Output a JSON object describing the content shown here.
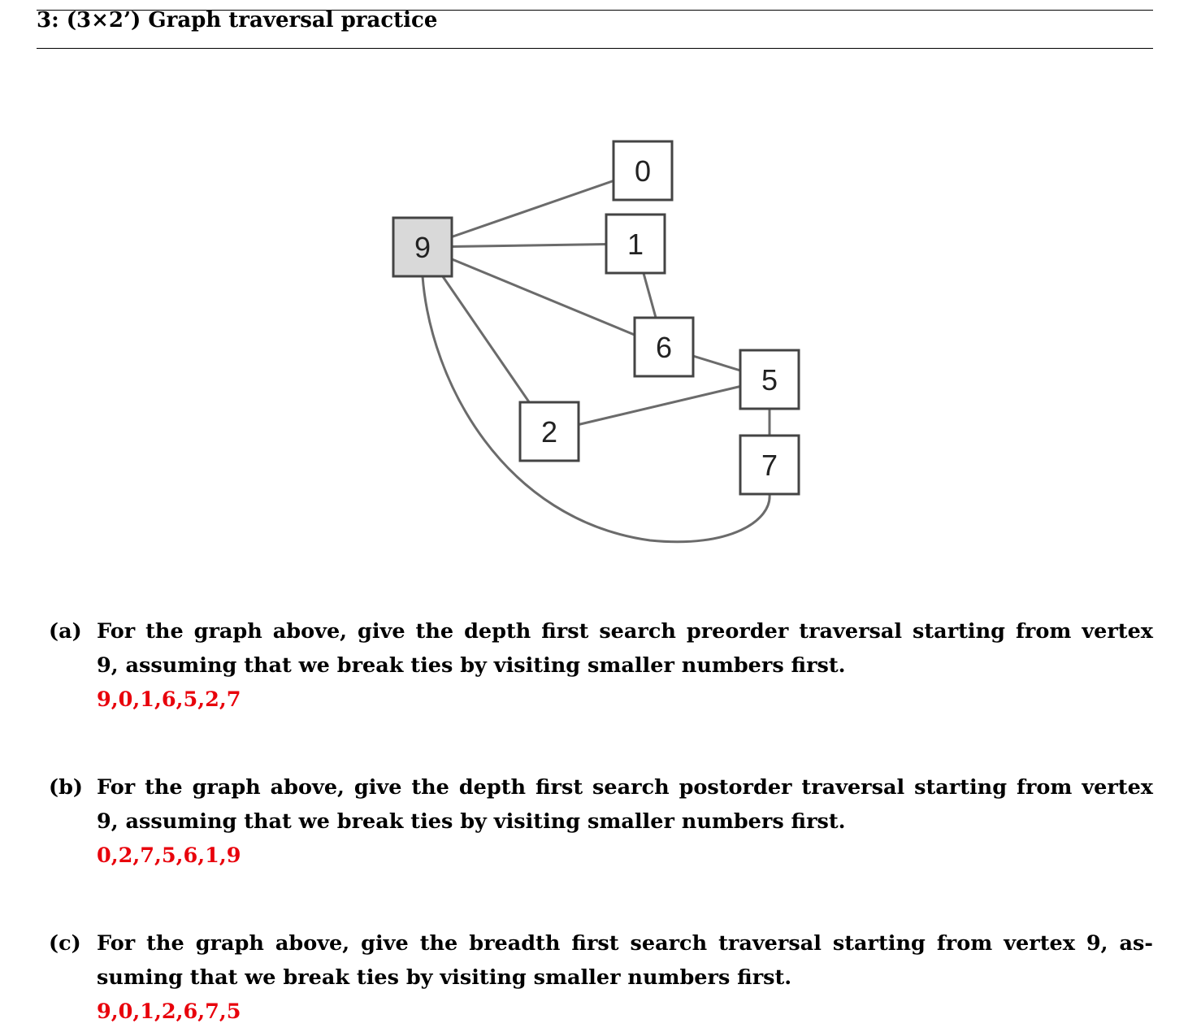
{
  "header": {
    "title": "3: (3×2’) Graph traversal practice"
  },
  "graph": {
    "nodes": [
      {
        "id": "0",
        "label": "0",
        "shaded": false
      },
      {
        "id": "1",
        "label": "1",
        "shaded": false
      },
      {
        "id": "9",
        "label": "9",
        "shaded": true
      },
      {
        "id": "6",
        "label": "6",
        "shaded": false
      },
      {
        "id": "5",
        "label": "5",
        "shaded": false
      },
      {
        "id": "2",
        "label": "2",
        "shaded": false
      },
      {
        "id": "7",
        "label": "7",
        "shaded": false
      }
    ],
    "edges": [
      [
        "9",
        "0"
      ],
      [
        "9",
        "1"
      ],
      [
        "9",
        "6"
      ],
      [
        "9",
        "2"
      ],
      [
        "9",
        "7"
      ],
      [
        "1",
        "6"
      ],
      [
        "6",
        "5"
      ],
      [
        "2",
        "5"
      ],
      [
        "5",
        "7"
      ]
    ],
    "colors": {
      "node_fill": "#ffffff",
      "node_shaded_fill": "#d9d9d9",
      "edge": "#6b6b6b",
      "node_border": "#444444"
    }
  },
  "questions": [
    {
      "number": "(a)",
      "lines": [
        "For the graph above, give the depth first search preorder traversal starting from vertex",
        "9, assuming that we break ties by visiting smaller numbers first."
      ],
      "answer": "9,0,1,6,5,2,7"
    },
    {
      "number": "(b)",
      "lines": [
        "For the graph above, give the depth first search postorder traversal starting from vertex",
        "9, assuming that we break ties by visiting smaller numbers first."
      ],
      "answer": "0,2,7,5,6,1,9"
    },
    {
      "number": "(c)",
      "lines": [
        "For the graph above, give the breadth first search traversal starting from vertex 9, as-",
        "suming that we break ties by visiting smaller numbers first."
      ],
      "answer": "9,0,1,2,6,7,5"
    }
  ],
  "answer_color": "#e8000b"
}
